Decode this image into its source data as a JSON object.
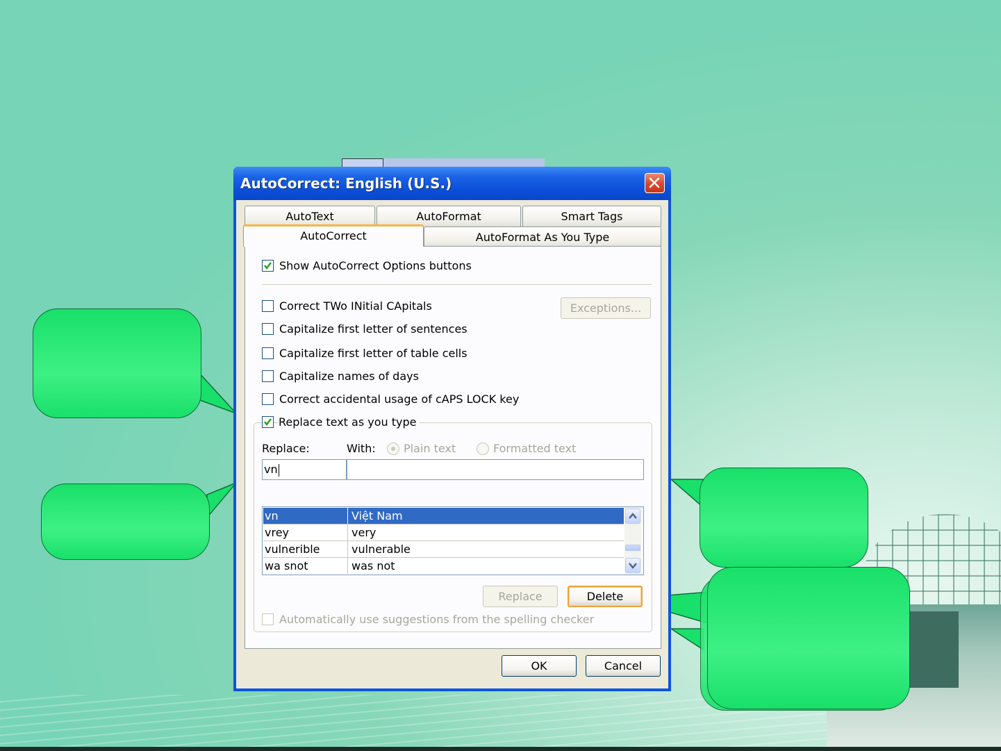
{
  "dialog": {
    "title": "AutoCorrect: English (U.S.)",
    "tabs_row1": [
      "AutoText",
      "AutoFormat",
      "Smart Tags"
    ],
    "tabs_row2": [
      "AutoCorrect",
      "AutoFormat As You Type"
    ],
    "selected_tab": "AutoCorrect"
  },
  "options": {
    "show_buttons": {
      "label": "Show AutoCorrect Options buttons",
      "checked": true
    },
    "correct_two_initial": {
      "label": "Correct TWo INitial CApitals",
      "checked": false
    },
    "cap_sentences": {
      "label": "Capitalize first letter of sentences",
      "checked": false
    },
    "cap_table_cells": {
      "label": "Capitalize first letter of table cells",
      "checked": false
    },
    "cap_days": {
      "label": "Capitalize names of days",
      "checked": false
    },
    "caps_lock": {
      "label": "Correct accidental usage of cAPS LOCK key",
      "checked": false
    },
    "replace_text": {
      "label": "Replace text as you type",
      "checked": true
    },
    "auto_suggest": {
      "label": "Automatically use suggestions from the spelling checker",
      "checked": false,
      "disabled": true
    }
  },
  "buttons": {
    "exceptions": "Exceptions...",
    "replace": "Replace",
    "delete": "Delete",
    "ok": "OK",
    "cancel": "Cancel"
  },
  "replace_section": {
    "replace_label": "Replace:",
    "with_label": "With:",
    "plain_text": "Plain text",
    "formatted_text": "Formatted text",
    "replace_value": "vn",
    "with_value": ""
  },
  "entries": [
    {
      "from": "vn",
      "to": "Việt Nam",
      "selected": true
    },
    {
      "from": "vrey",
      "to": "very"
    },
    {
      "from": "vulnerible",
      "to": "vulnerable"
    },
    {
      "from": "wa snot",
      "to": "was not"
    }
  ],
  "colors": {
    "callout_fill": "#19e06a",
    "titlebar": "#0b4fd8",
    "selection": "#316ac5",
    "background": "#77d4b6"
  }
}
